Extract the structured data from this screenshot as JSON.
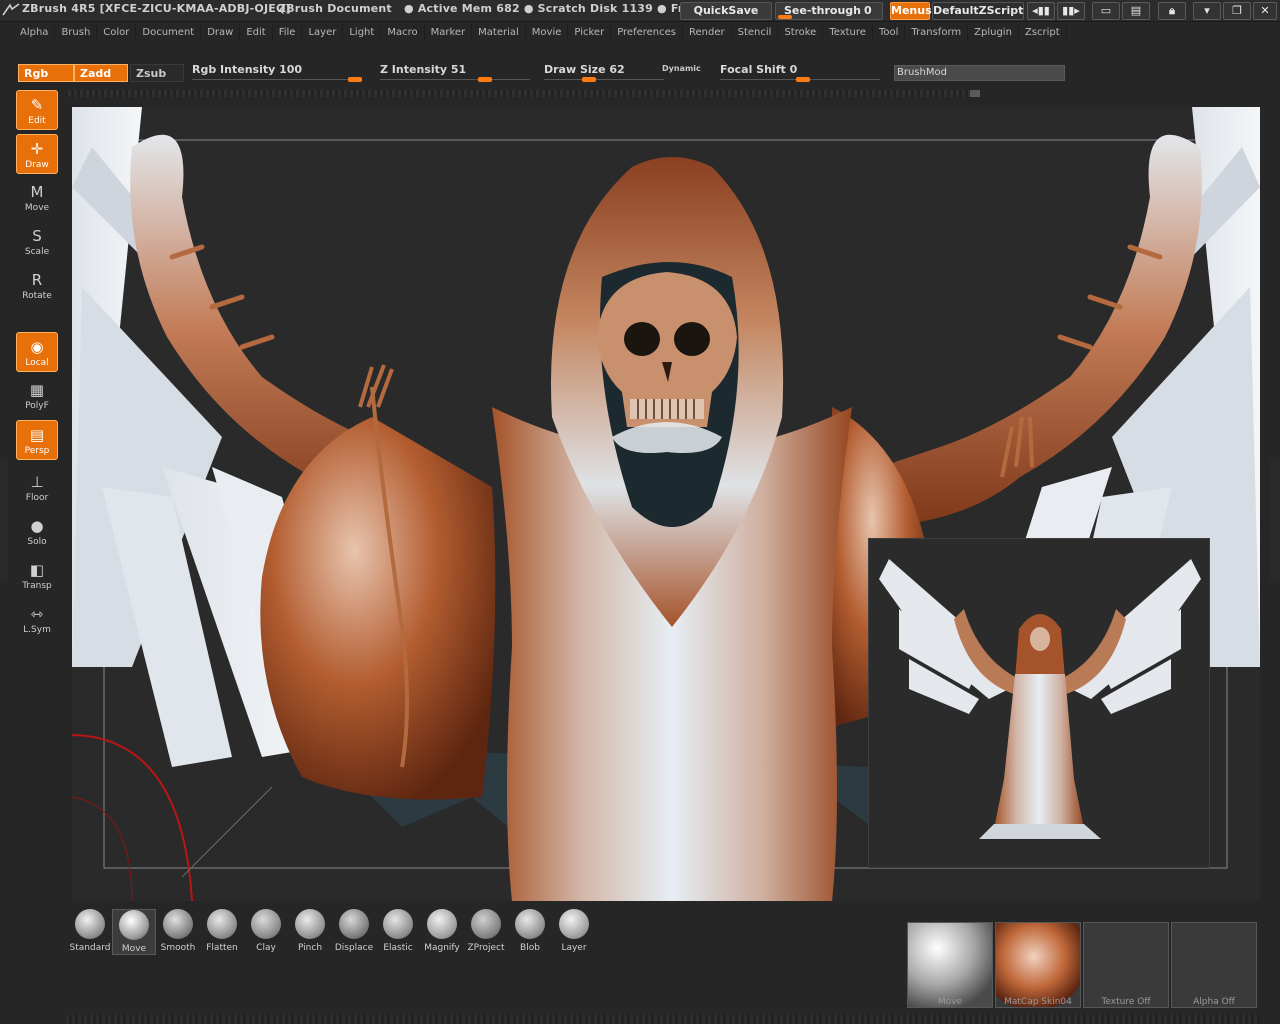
{
  "titlebar": {
    "app": "ZBrush 4R5 [XFCE-ZICU-KMAA-ADBJ-OJEQ]",
    "document": "ZBrush Document",
    "mem": "● Active Mem 682 ● Scratch Disk 1139 ● Fre",
    "quicksave": "QuickSave",
    "seethrough": "See-through",
    "seethrough_val": "0",
    "menus": "Menus",
    "zscript": "DefaultZScript"
  },
  "menu": [
    "Alpha",
    "Brush",
    "Color",
    "Document",
    "Draw",
    "Edit",
    "File",
    "Layer",
    "Light",
    "Macro",
    "Marker",
    "Material",
    "Movie",
    "Picker",
    "Preferences",
    "Render",
    "Stencil",
    "Stroke",
    "Texture",
    "Tool",
    "Transform",
    "Zplugin",
    "Zscript"
  ],
  "shelf": {
    "rgb": "Rgb",
    "zadd": "Zadd",
    "zsub": "Zsub",
    "rgb_intensity": "Rgb Intensity 100",
    "z_intensity": "Z Intensity 51",
    "draw_size": "Draw Size 62",
    "dynamic": "Dynamic",
    "focal_shift": "Focal Shift 0",
    "brushmod": "BrushMod",
    "rgb_intensity_value": 100,
    "z_intensity_value": 51,
    "focal_shift_value": 0
  },
  "lefttools": [
    "Edit",
    "Draw",
    "Move",
    "Scale",
    "Rotate",
    "Local",
    "PolyF",
    "Persp",
    "Floor",
    "Solo",
    "Transp",
    "L.Sym"
  ],
  "brushes": [
    "Standard",
    "Move",
    "Smooth",
    "Flatten",
    "Clay",
    "Pinch",
    "Displace",
    "Elastic",
    "Magnify",
    "ZProject",
    "Blob",
    "Layer"
  ],
  "slots": {
    "brush": "Move",
    "material": "MatCap Skin04",
    "texture": "Texture Off",
    "alpha": "Alpha Off"
  },
  "colors": {
    "accent": "#e8700a",
    "skin": "#a5532a",
    "highlight": "#e6eef4"
  }
}
